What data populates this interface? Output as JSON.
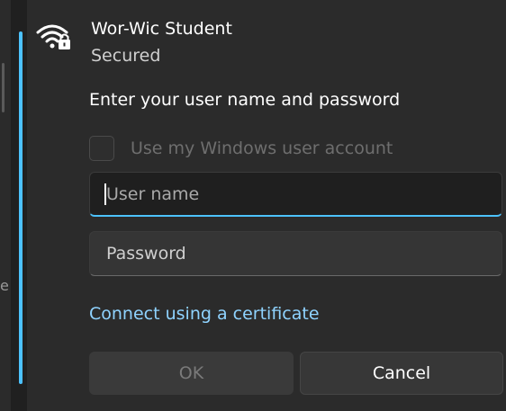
{
  "network": {
    "name": "Wor-Wic Student",
    "status": "Secured",
    "icon": "wifi-secured-icon"
  },
  "auth": {
    "prompt": "Enter your user name and password",
    "use_windows_account_label": "Use my Windows user account",
    "use_windows_account_checked": false,
    "username": {
      "value": "",
      "placeholder": "User name"
    },
    "password": {
      "value": "",
      "placeholder": "Password"
    },
    "certificate_link": "Connect using a certificate"
  },
  "buttons": {
    "ok_label": "OK",
    "cancel_label": "Cancel"
  },
  "background": {
    "clipped_char": "e"
  },
  "colors": {
    "accent": "#4cc2ff",
    "link": "#8fd3ff",
    "panel": "#2b2b2b"
  }
}
